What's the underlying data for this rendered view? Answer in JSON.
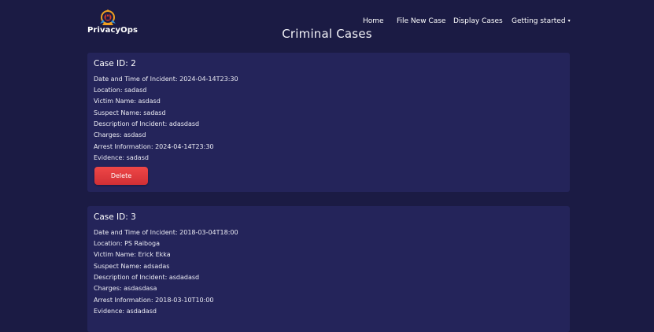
{
  "brand": {
    "name": "PrivacyOps",
    "logo_icon": "lock-shield-icon"
  },
  "nav": {
    "items": [
      "Home",
      "File New Case",
      "Display Cases",
      "Getting started"
    ],
    "dropdown_caret": "▾"
  },
  "page": {
    "title": "Criminal Cases"
  },
  "labels": {
    "date": "Date and Time of Incident:",
    "location": "Location:",
    "victim": "Victim Name:",
    "suspect": "Suspect Name:",
    "description": "Description of Incident:",
    "charges": "Charges:",
    "arrest": "Arrest Information:",
    "evidence": "Evidence:"
  },
  "cases": [
    {
      "id_label": "Case ID: 2",
      "date": "2024-04-14T23:30",
      "location": "sadasd",
      "victim": "asdasd",
      "suspect": "sadasd",
      "description": "adasdasd",
      "charges": "asdasd",
      "arrest": "2024-04-14T23:30",
      "evidence": "sadasd",
      "delete_label": "Delete"
    },
    {
      "id_label": "Case ID: 3",
      "date": "2018-03-04T18:00",
      "location": "PS Raiboga",
      "victim": "Erick Ekka",
      "suspect": "adsadas",
      "description": "asdadasd",
      "charges": "asdasdasa",
      "arrest": "2018-03-10T10:00",
      "evidence": "asdadasd"
    }
  ],
  "colors": {
    "background": "#1b1b44",
    "card": "#24245a",
    "delete_button": "#e53b3f"
  }
}
